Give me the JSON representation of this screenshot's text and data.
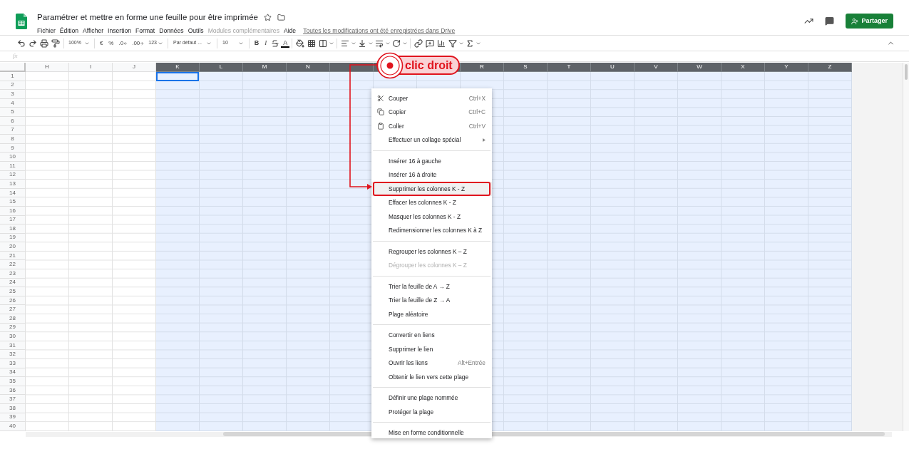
{
  "document": {
    "title": "Paramétrer et mettre en forme une feuille pour être imprimée",
    "saved_status": "Toutes les modifications ont été enregistrées dans Drive"
  },
  "menu_bar": [
    {
      "label": "Fichier",
      "disabled": false
    },
    {
      "label": "Édition",
      "disabled": false
    },
    {
      "label": "Afficher",
      "disabled": false
    },
    {
      "label": "Insertion",
      "disabled": false
    },
    {
      "label": "Format",
      "disabled": false
    },
    {
      "label": "Données",
      "disabled": false
    },
    {
      "label": "Outils",
      "disabled": false
    },
    {
      "label": "Modules complémentaires",
      "disabled": true
    },
    {
      "label": "Aide",
      "disabled": false
    }
  ],
  "share_button": {
    "label": "Partager"
  },
  "toolbar": {
    "zoom": "100%",
    "currency": "€",
    "percent": "%",
    "decimal_decrease": ".0",
    "decimal_increase": ".00",
    "number_format": "123",
    "font": "Par défaut ...",
    "font_size": "10",
    "bold": "B",
    "italic": "I",
    "text_color": "A"
  },
  "formula_bar": {
    "label": "fx"
  },
  "columns": [
    {
      "label": "H",
      "selected": false,
      "active_cell": false
    },
    {
      "label": "I",
      "selected": false,
      "active_cell": false
    },
    {
      "label": "J",
      "selected": false,
      "active_cell": false
    },
    {
      "label": "K",
      "selected": true,
      "active_cell": true
    },
    {
      "label": "L",
      "selected": true,
      "active_cell": false
    },
    {
      "label": "M",
      "selected": true,
      "active_cell": false
    },
    {
      "label": "N",
      "selected": true,
      "active_cell": false
    },
    {
      "selected": true,
      "active_cell": false
    },
    {
      "selected": true,
      "active_cell": false
    },
    {
      "selected": true,
      "active_cell": false
    },
    {
      "label": "R",
      "selected": true,
      "active_cell": false
    },
    {
      "label": "S",
      "selected": true,
      "active_cell": false
    },
    {
      "label": "T",
      "selected": true,
      "active_cell": false
    },
    {
      "label": "U",
      "selected": true,
      "active_cell": false
    },
    {
      "label": "V",
      "selected": true,
      "active_cell": false
    },
    {
      "label": "W",
      "selected": true,
      "active_cell": false
    },
    {
      "label": "X",
      "selected": true,
      "active_cell": false
    },
    {
      "label": "Y",
      "selected": true,
      "active_cell": false
    },
    {
      "label": "Z",
      "selected": true,
      "active_cell": false
    }
  ],
  "rows": [
    "1",
    "2",
    "3",
    "4",
    "5",
    "6",
    "7",
    "8",
    "9",
    "10",
    "11",
    "12",
    "13",
    "14",
    "15",
    "16",
    "17",
    "18",
    "19",
    "20",
    "21",
    "22",
    "23",
    "24",
    "25",
    "26",
    "27",
    "28",
    "29",
    "30",
    "31",
    "32",
    "33",
    "34",
    "35",
    "36",
    "37",
    "38",
    "39",
    "40"
  ],
  "context_menu": {
    "sections": [
      [
        {
          "label": "Couper",
          "shortcut": "Ctrl+X",
          "submenu": false,
          "disabled": false,
          "highlighted": false
        },
        {
          "label": "Copier",
          "shortcut": "Ctrl+C",
          "submenu": false,
          "disabled": false,
          "highlighted": false
        },
        {
          "label": "Coller",
          "shortcut": "Ctrl+V",
          "submenu": false,
          "disabled": false,
          "highlighted": false
        },
        {
          "label": "Effectuer un collage spécial",
          "submenu": true,
          "disabled": false,
          "highlighted": false
        }
      ],
      [
        {
          "label": "Insérer 16 à gauche",
          "submenu": false,
          "disabled": false,
          "highlighted": false
        },
        {
          "label": "Insérer 16 à droite",
          "submenu": false,
          "disabled": false,
          "highlighted": false
        },
        {
          "label": "Supprimer les colonnes K - Z",
          "submenu": false,
          "disabled": false,
          "highlighted": true
        },
        {
          "label": "Effacer les colonnes K - Z",
          "submenu": false,
          "disabled": false,
          "highlighted": false
        },
        {
          "label": "Masquer les colonnes K - Z",
          "submenu": false,
          "disabled": false,
          "highlighted": false
        },
        {
          "label": "Redimensionner les colonnes K à Z",
          "submenu": false,
          "disabled": false,
          "highlighted": false
        }
      ],
      [
        {
          "label": "Regrouper les colonnes K – Z",
          "submenu": false,
          "disabled": false,
          "highlighted": false
        },
        {
          "label": "Dégrouper les colonnes K – Z",
          "submenu": false,
          "disabled": true,
          "highlighted": false
        }
      ],
      [
        {
          "label": "Trier la feuille de A → Z",
          "submenu": false,
          "disabled": false,
          "highlighted": false
        },
        {
          "label": "Trier la feuille de Z → A",
          "submenu": false,
          "disabled": false,
          "highlighted": false
        },
        {
          "label": "Plage aléatoire",
          "submenu": false,
          "disabled": false,
          "highlighted": false
        }
      ],
      [
        {
          "label": "Convertir en liens",
          "submenu": false,
          "disabled": false,
          "highlighted": false
        },
        {
          "label": "Supprimer le lien",
          "submenu": false,
          "disabled": false,
          "highlighted": false
        },
        {
          "label": "Ouvrir les liens",
          "shortcut": "Alt+Entrée",
          "submenu": false,
          "disabled": false,
          "highlighted": false
        },
        {
          "label": "Obtenir le lien vers cette plage",
          "submenu": false,
          "disabled": false,
          "highlighted": false
        }
      ],
      [
        {
          "label": "Définir une plage nommée",
          "submenu": false,
          "disabled": false,
          "highlighted": false
        },
        {
          "label": "Protéger la plage",
          "submenu": false,
          "disabled": false,
          "highlighted": false
        }
      ],
      [
        {
          "label": "Mise en forme conditionnelle",
          "submenu": false,
          "disabled": false,
          "highlighted": false
        }
      ]
    ]
  },
  "annotation": {
    "label": "clic droit"
  }
}
